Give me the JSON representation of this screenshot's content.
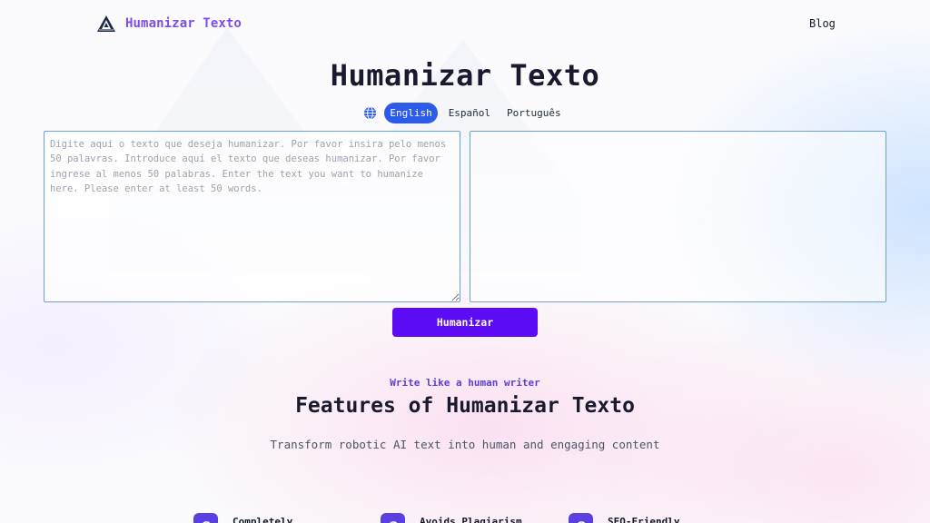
{
  "header": {
    "brand": "Humanizar Texto",
    "nav_blog": "Blog"
  },
  "hero": {
    "title": "Humanizar Texto"
  },
  "languages": {
    "options": [
      "English",
      "Español",
      "Português"
    ],
    "selected": "English"
  },
  "editor": {
    "input_placeholder": "Digite aqui o texto que deseja humanizar. Por favor insira pelo menos 50 palavras. Introduce aquí el texto que deseas humanizar. Por favor ingrese al menos 50 palabras. Enter the text you want to humanize here. Please enter at least 50 words.",
    "input_value": "",
    "output_value": "",
    "submit_label": "Humanizar"
  },
  "features": {
    "eyebrow": "Write like a human writer",
    "title": "Features of Humanizar Texto",
    "subtitle": "Transform robotic AI text into human and engaging content",
    "items": [
      {
        "label": "Completely",
        "icon": "refresh-icon"
      },
      {
        "label": "Avoids Plagiarism",
        "icon": "refresh-icon"
      },
      {
        "label": "SEO-Friendly",
        "icon": "refresh-icon"
      }
    ]
  },
  "colors": {
    "brand": "#7c4de8",
    "active_language": "#2b5be8",
    "primary_button": "#5b0cf5",
    "feature_icon": "#5b3fe0"
  }
}
